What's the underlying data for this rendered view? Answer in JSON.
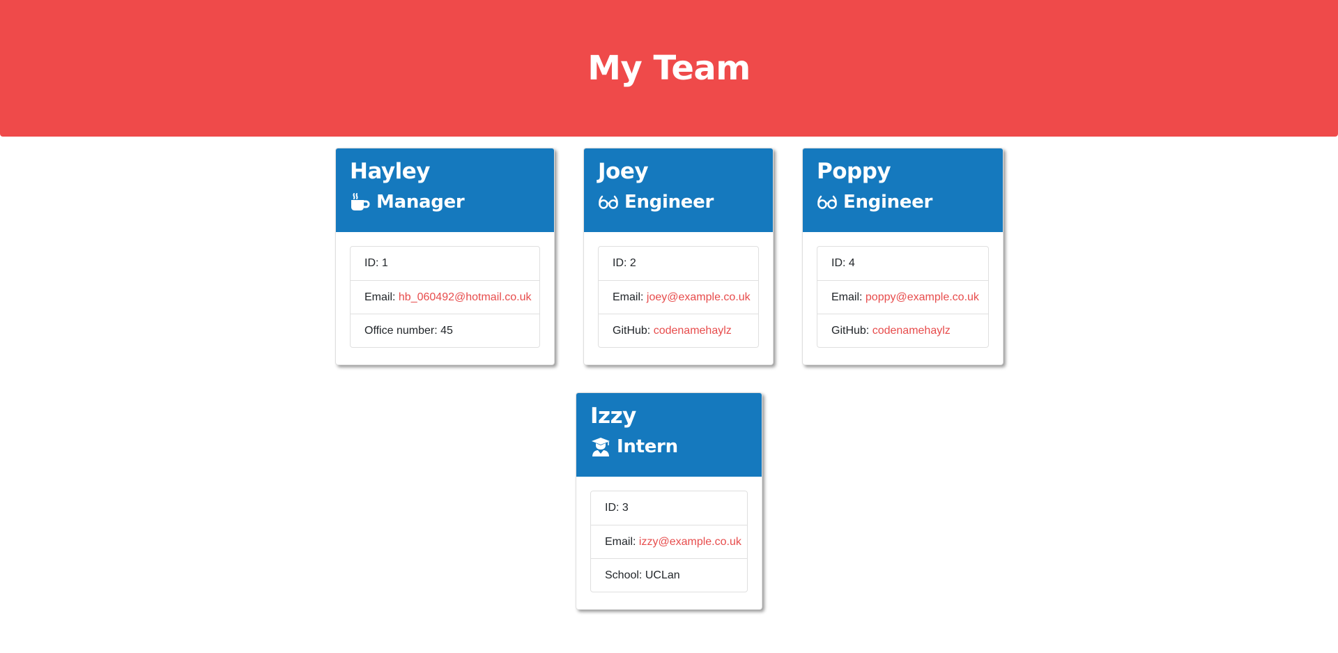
{
  "header": {
    "title": "My Team"
  },
  "team": [
    {
      "name": "Hayley",
      "role": "Manager",
      "icon": "coffee-icon",
      "id_label": "ID:",
      "id": "1",
      "email_label": "Email:",
      "email": "hb_060492@hotmail.co.uk",
      "extra_label": "Office number:",
      "extra_value": "45",
      "extra_is_link": false
    },
    {
      "name": "Joey",
      "role": "Engineer",
      "icon": "glasses-icon",
      "id_label": "ID:",
      "id": "2",
      "email_label": "Email:",
      "email": "joey@example.co.uk",
      "extra_label": "GitHub:",
      "extra_value": "codenamehaylz",
      "extra_is_link": true
    },
    {
      "name": "Poppy",
      "role": "Engineer",
      "icon": "glasses-icon",
      "id_label": "ID:",
      "id": "4",
      "email_label": "Email:",
      "email": "poppy@example.co.uk",
      "extra_label": "GitHub:",
      "extra_value": "codenamehaylz",
      "extra_is_link": true
    },
    {
      "name": "Izzy",
      "role": "Intern",
      "icon": "graduate-icon",
      "id_label": "ID:",
      "id": "3",
      "email_label": "Email:",
      "email": "izzy@example.co.uk",
      "extra_label": "School:",
      "extra_value": "UCLan",
      "extra_is_link": false
    }
  ],
  "colors": {
    "header_bg": "#ef4a4a",
    "card_header_bg": "#1579be",
    "link": "#e74c4c"
  }
}
